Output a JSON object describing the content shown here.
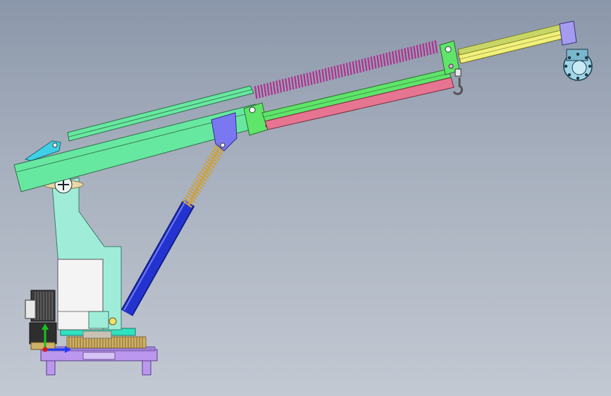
{
  "viewport": {
    "background_top": "#8b97aa",
    "background_bottom": "#c3c9d3"
  },
  "colors": {
    "boom_green": "#67e8a0",
    "boom_pink": "#e57590",
    "inner_green": "#5ee56a",
    "tip_yellow": "#f1f07a",
    "column_cyan": "#9fedd8",
    "cylinder_blue": "#2433d0",
    "base_purple": "#bb98ee",
    "spring_magenta": "#b0308f",
    "spring_tan": "#c8a24a",
    "block_blue": "#7a78f0",
    "motor_gray": "#3c3c3c",
    "gear_tan": "#cfb066"
  },
  "triad": {
    "x_axis_color": "#1e3cff",
    "y_axis_color": "#17c21f",
    "z_axis_color": "#d81a1a"
  }
}
